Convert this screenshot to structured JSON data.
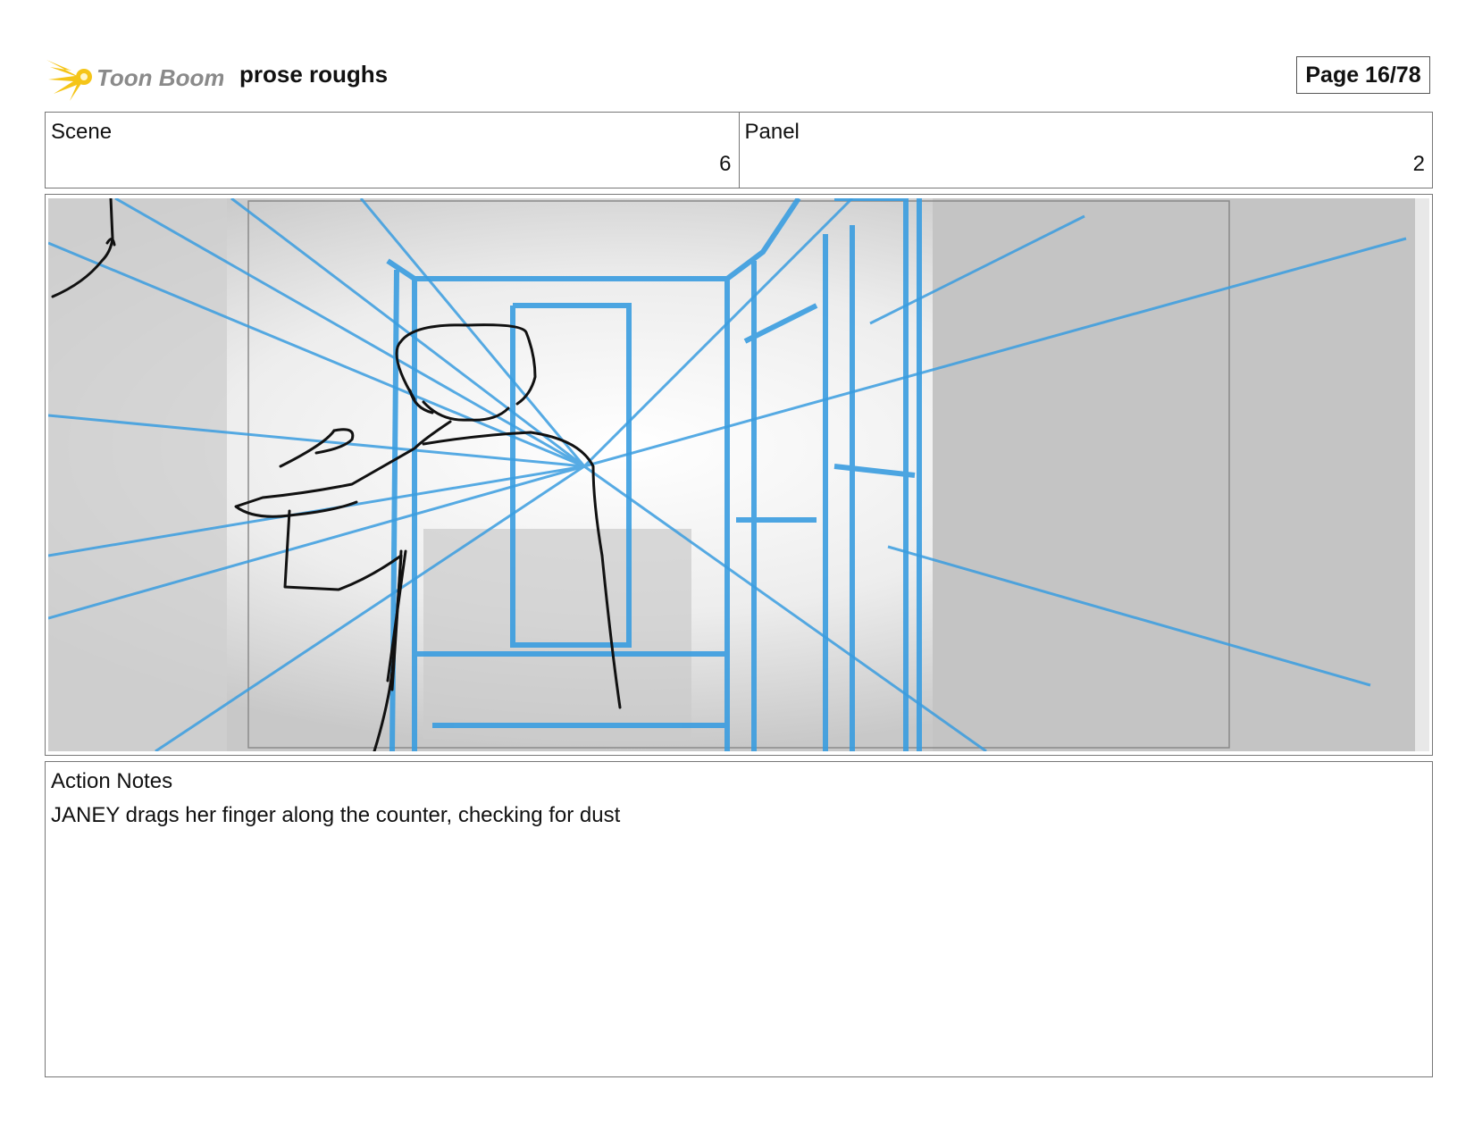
{
  "header": {
    "logo_text": "Toon Boom",
    "project_title": "prose roughs",
    "page_label": "Page 16/78"
  },
  "info": {
    "scene_label": "Scene",
    "scene_value": "6",
    "panel_label": "Panel",
    "panel_value": "2"
  },
  "panel_image": {
    "description_icon": "storyboard-sketch-image"
  },
  "notes": {
    "label": "Action Notes",
    "text": "JANEY drags her finger along the counter, checking for dust"
  },
  "colors": {
    "sketch_blue": "#3a9de0",
    "sketch_black": "#111111",
    "logo_yellow": "#f5c518",
    "logo_gray": "#8a8a8a"
  }
}
